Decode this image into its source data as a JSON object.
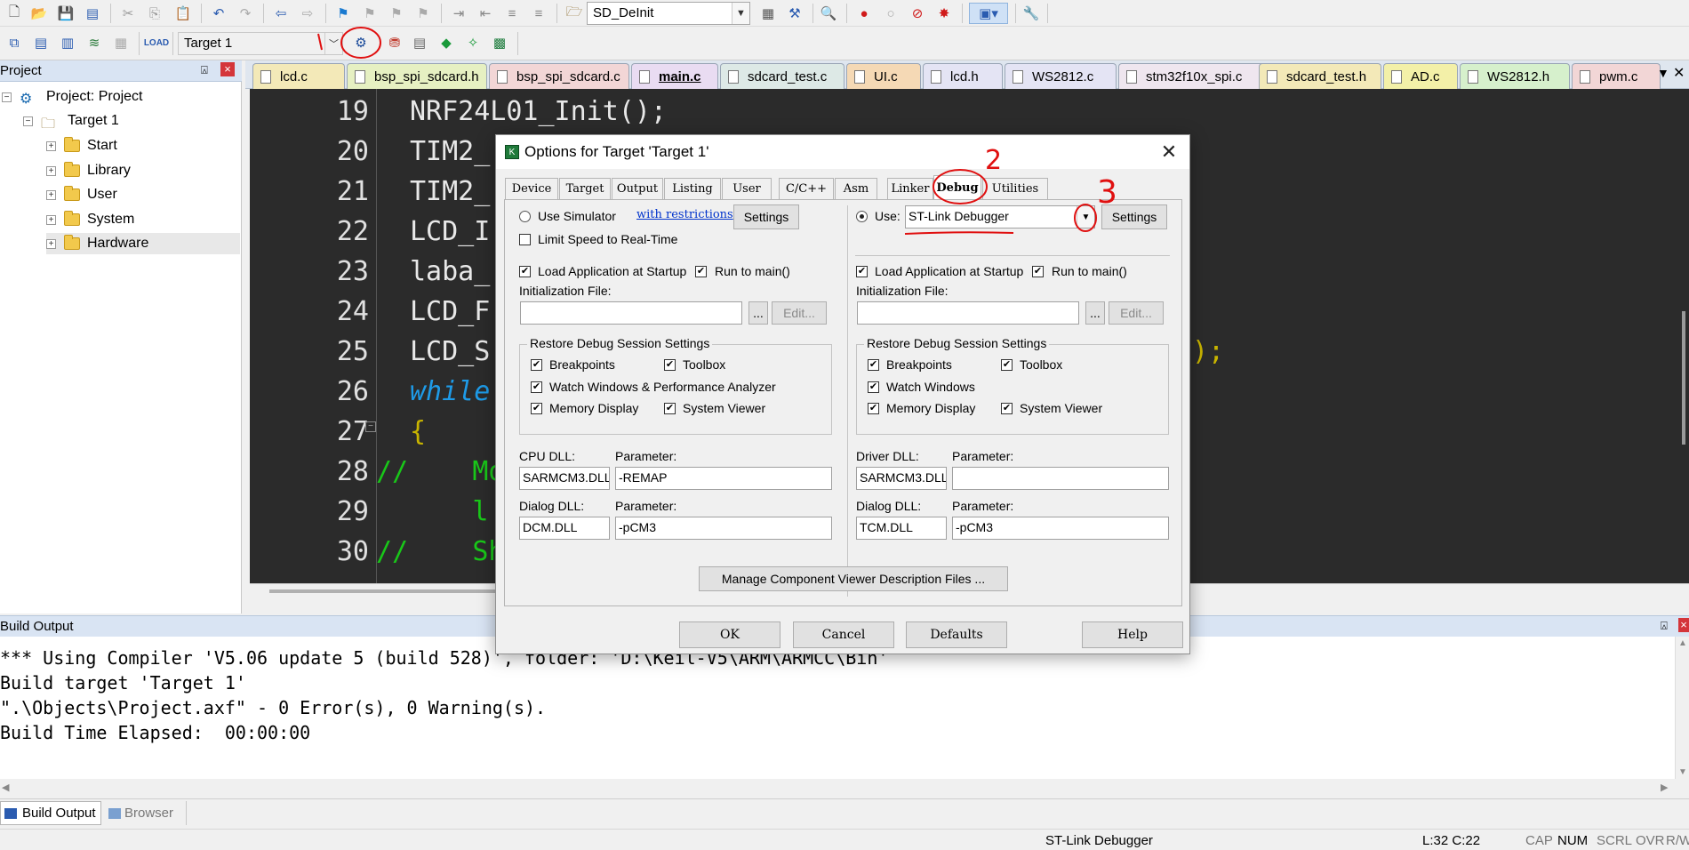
{
  "toolbar": {
    "target_select": "SD_DeInit",
    "target_combo": "Target 1"
  },
  "project_panel": {
    "title": "Project",
    "pin": "⍓",
    "close": "×",
    "root": "Project: Project",
    "target": "Target 1",
    "groups": [
      "Start",
      "Library",
      "User",
      "System",
      "Hardware"
    ]
  },
  "tabs": [
    "lcd.c",
    "bsp_spi_sdcard.h",
    "bsp_spi_sdcard.c",
    "main.c",
    "sdcard_test.c",
    "UI.c",
    "lcd.h",
    "WS2812.c",
    "stm32f10x_spi.c",
    "sdcard_test.h",
    "AD.c",
    "WS2812.h",
    "pwm.c"
  ],
  "tab_colors": [
    "#f3e9b8",
    "#e6f0c2",
    "#f2d6d6",
    "#e9dcf2",
    "#dde9e6",
    "#f5d9b5",
    "#e4e4f4",
    "#e4e4f4",
    "#efe6ef",
    "#f3e9b8",
    "#f3f0a8",
    "#d6f0cc",
    "#f2d6d6"
  ],
  "editor": {
    "lines": [
      {
        "num": "19",
        "text": "NRF24L01_Init();"
      },
      {
        "num": "20",
        "text": "TIM2_"
      },
      {
        "num": "21",
        "text": "TIM2_"
      },
      {
        "num": "22",
        "text": "LCD_I"
      },
      {
        "num": "23",
        "text": "laba_"
      },
      {
        "num": "24",
        "text": "LCD_F"
      },
      {
        "num": "25",
        "text": "LCD_S",
        "tail": ");"
      },
      {
        "num": "26",
        "text": "while"
      },
      {
        "num": "27",
        "text": "{"
      },
      {
        "num": "28",
        "text": "//    Mo"
      },
      {
        "num": "29",
        "text": "      l"
      },
      {
        "num": "30",
        "text": "//    Sh"
      }
    ]
  },
  "dialog": {
    "title": "Options for Target 'Target 1'",
    "close": "✕",
    "tabs": [
      "Device",
      "Target",
      "Output",
      "Listing",
      "User",
      "C/C++",
      "Asm",
      "Linker",
      "Debug",
      "Utilities"
    ],
    "active_tab": "Debug",
    "left": {
      "use_simulator": "Use Simulator",
      "with_restrictions": "with restrictions",
      "settings": "Settings",
      "limit_speed": "Limit Speed to Real-Time",
      "load_app": "Load Application at Startup",
      "run_to_main": "Run to main()",
      "init_file_label": "Initialization File:",
      "browse": "...",
      "edit": "Edit...",
      "restore_title": "Restore Debug Session Settings",
      "breakpoints": "Breakpoints",
      "toolbox": "Toolbox",
      "watch": "Watch Windows & Performance Analyzer",
      "memory": "Memory Display",
      "system_viewer": "System Viewer",
      "cpu_dll_label": "CPU DLL:",
      "cpu_param_label": "Parameter:",
      "cpu_dll": "SARMCM3.DLL",
      "cpu_param": "-REMAP",
      "dialog_dll_label": "Dialog DLL:",
      "dialog_param_label": "Parameter:",
      "dialog_dll": "DCM.DLL",
      "dialog_param": "-pCM3"
    },
    "right": {
      "use": "Use:",
      "debugger": "ST-Link Debugger",
      "settings": "Settings",
      "load_app": "Load Application at Startup",
      "run_to_main": "Run to main()",
      "init_file_label": "Initialization File:",
      "browse": "...",
      "edit": "Edit...",
      "restore_title": "Restore Debug Session Settings",
      "breakpoints": "Breakpoints",
      "toolbox": "Toolbox",
      "watch": "Watch Windows",
      "memory": "Memory Display",
      "system_viewer": "System Viewer",
      "driver_dll_label": "Driver DLL:",
      "driver_param_label": "Parameter:",
      "driver_dll": "SARMCM3.DLL",
      "driver_param": "",
      "dialog_dll_label": "Dialog DLL:",
      "dialog_param_label": "Parameter:",
      "dialog_dll": "TCM.DLL",
      "dialog_param": "-pCM3"
    },
    "manage_button": "Manage Component Viewer Description Files ...",
    "ok": "OK",
    "cancel": "Cancel",
    "defaults": "Defaults",
    "help": "Help"
  },
  "annotations": {
    "two": "2",
    "three": "3"
  },
  "build_output": {
    "title": "Build Output",
    "lines": [
      "*** Using Compiler 'V5.06 update 5 (build 528)', folder: 'D:\\Keil-V5\\ARM\\ARMCC\\Bin'",
      "Build target 'Target 1'",
      "\".\\Objects\\Project.axf\" - 0 Error(s), 0 Warning(s).",
      "Build Time Elapsed:  00:00:00"
    ],
    "tab_build": "Build Output",
    "tab_browser": "Browser"
  },
  "status": {
    "debugger": "ST-Link Debugger",
    "position": "L:32 C:22",
    "cap": "CAP",
    "num": "NUM",
    "scrl": "SCRL",
    "ovr": "OVR",
    "rw": "R/W"
  }
}
